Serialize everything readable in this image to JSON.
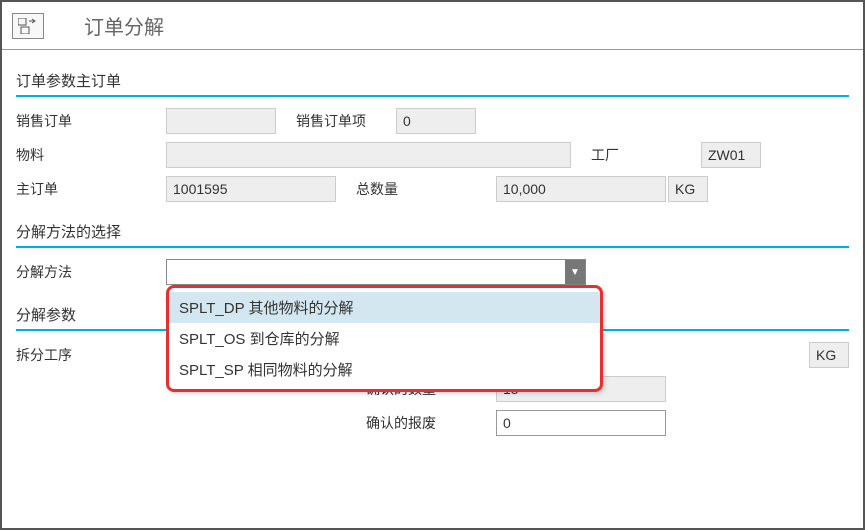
{
  "header": {
    "title": "订单分解"
  },
  "section1": {
    "title": "订单参数主订单",
    "sales_order_label": "销售订单",
    "sales_order_value": "",
    "sales_item_label": "销售订单项",
    "sales_item_value": "0",
    "material_label": "物料",
    "material_value": "",
    "plant_label": "工厂",
    "plant_value": "ZW01",
    "main_order_label": "主订单",
    "main_order_value": "1001595",
    "total_qty_label": "总数量",
    "total_qty_value": "10,000",
    "total_qty_unit": "KG"
  },
  "section2": {
    "title": "分解方法的选择",
    "method_label": "分解方法",
    "method_value": "",
    "options": [
      {
        "text": "SPLT_DP 其他物料的分解",
        "selected": true
      },
      {
        "text": "SPLT_OS 到仓库的分解",
        "selected": false
      },
      {
        "text": "SPLT_SP 相同物料的分解",
        "selected": false
      }
    ]
  },
  "section3": {
    "title": "分解参数",
    "split_op_label": "拆分工序",
    "split_op_unit": "KG",
    "conf_qty_label": "确认的数量",
    "conf_qty_value": "15",
    "conf_scrap_label": "确认的报废",
    "conf_scrap_value": "0"
  }
}
